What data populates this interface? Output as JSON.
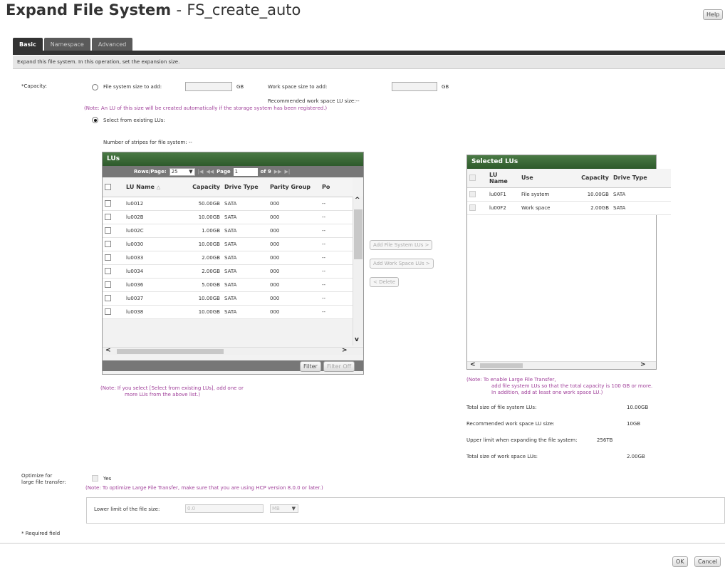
{
  "header": {
    "title": "Expand File System",
    "separator": "-",
    "subtitle": "FS_create_auto",
    "help": "Help"
  },
  "tabs": [
    {
      "label": "Basic",
      "active": true
    },
    {
      "label": "Namespace",
      "active": false
    },
    {
      "label": "Advanced",
      "active": false
    }
  ],
  "description": "Expand this file system. In this operation, set the expansion size.",
  "capacity": {
    "label": "*Capacity:",
    "option_size": "File system size to add:",
    "unit_gb": "GB",
    "work_space_label": "Work space size to add:",
    "recommended_work_space": "Recommended work space LU size:--",
    "note_auto": "(Note: An LU of this size will be created automatically if the storage system has been registered.)",
    "option_existing": "Select from existing LUs:",
    "stripes": "Number of stripes for file system: --"
  },
  "lus_panel": {
    "title": "LUs",
    "rows_per_page_label": "Rows/Page:",
    "rows_per_page": "25",
    "page_label": "Page",
    "page_value": "1",
    "of_pages": "of 9",
    "columns": [
      "LU Name",
      "Capacity",
      "Drive Type",
      "Parity Group",
      "Po"
    ],
    "rows": [
      [
        "lu0012",
        "50.00GB",
        "SATA",
        "000",
        "--"
      ],
      [
        "lu002B",
        "10.00GB",
        "SATA",
        "000",
        "--"
      ],
      [
        "lu002C",
        "1.00GB",
        "SATA",
        "000",
        "--"
      ],
      [
        "lu0030",
        "10.00GB",
        "SATA",
        "000",
        "--"
      ],
      [
        "lu0033",
        "2.00GB",
        "SATA",
        "000",
        "--"
      ],
      [
        "lu0034",
        "2.00GB",
        "SATA",
        "000",
        "--"
      ],
      [
        "lu0036",
        "5.00GB",
        "SATA",
        "000",
        "--"
      ],
      [
        "lu0037",
        "10.00GB",
        "SATA",
        "000",
        "--"
      ],
      [
        "lu0038",
        "10.00GB",
        "SATA",
        "000",
        "--"
      ]
    ],
    "filter": "Filter",
    "filter_off": "Filter Off",
    "note_line1": "(Note: If you select [Select from existing LUs], add one or",
    "note_line2": "more LUs from the above list.)"
  },
  "actions": {
    "add_fs": "Add File System LUs >",
    "add_ws": "Add Work Space LUs >",
    "delete": "< Delete"
  },
  "selected_panel": {
    "title": "Selected LUs",
    "columns": [
      "LU Name",
      "Use",
      "Capacity",
      "Drive Type"
    ],
    "rows": [
      [
        "lu00F1",
        "File system",
        "10.00GB",
        "SATA"
      ],
      [
        "lu00F2",
        "Work space",
        "2.00GB",
        "SATA"
      ]
    ],
    "note_line1": "(Note: To enable Large File Transfer,",
    "note_line2": "add file system LUs so that the total capacity is 100 GB or more.",
    "note_line3": "In addition, add at least one work space LU.)"
  },
  "summary": [
    {
      "label": "Total size of file system LUs:",
      "value": "10.00GB"
    },
    {
      "label": "Recommended work space LU size:",
      "value": "10GB"
    },
    {
      "label": "Upper limit when expanding the file system:",
      "value": "256TB"
    },
    {
      "label": "Total size of work space LUs:",
      "value": "2.00GB"
    }
  ],
  "optimize": {
    "label_line1": "Optimize for",
    "label_line2": "large file transfer:",
    "yes": "Yes",
    "note": "(Note: To optimize Large File Transfer, make sure that you are using HCP version 8.0.0 or later.)",
    "lower_limit_label": "Lower limit of the file size:",
    "lower_limit_value": "0.0",
    "unit": "MB"
  },
  "required": "* Required field",
  "footer": {
    "ok": "OK",
    "cancel": "Cancel"
  },
  "colors": {
    "panel_header": "#2e5a2b",
    "note": "#a0409a",
    "tab_bar": "#333333"
  }
}
